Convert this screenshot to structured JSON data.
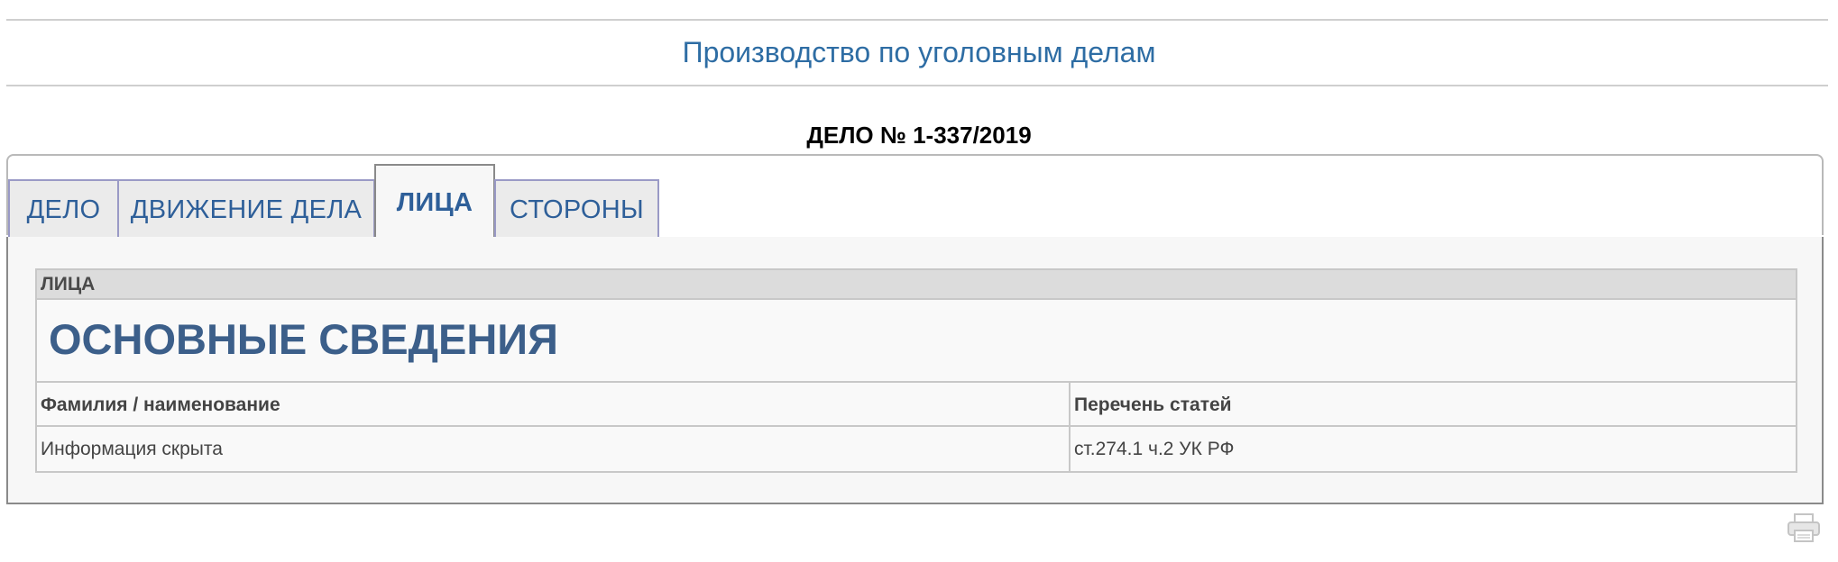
{
  "header": {
    "title": "Производство по уголовным делам"
  },
  "case": {
    "title": "ДЕЛО № 1-337/2019"
  },
  "tabs": [
    {
      "label": "ДЕЛО",
      "active": false
    },
    {
      "label": "ДВИЖЕНИЕ ДЕЛА",
      "active": false
    },
    {
      "label": "ЛИЦА",
      "active": true
    },
    {
      "label": "СТОРОНЫ",
      "active": false
    }
  ],
  "panel": {
    "bar_label": "ЛИЦА",
    "heading": "ОСНОВНЫЕ СВЕДЕНИЯ",
    "columns": [
      "Фамилия / наименование",
      "Перечень статей"
    ],
    "rows": [
      [
        "Информация скрыта",
        "ст.274.1 ч.2 УК РФ"
      ]
    ]
  },
  "icons": {
    "print": "printer-icon"
  },
  "colors": {
    "accent": "#2e6da4",
    "tab_text": "#2e5f99",
    "heading": "#3c5f8a"
  }
}
